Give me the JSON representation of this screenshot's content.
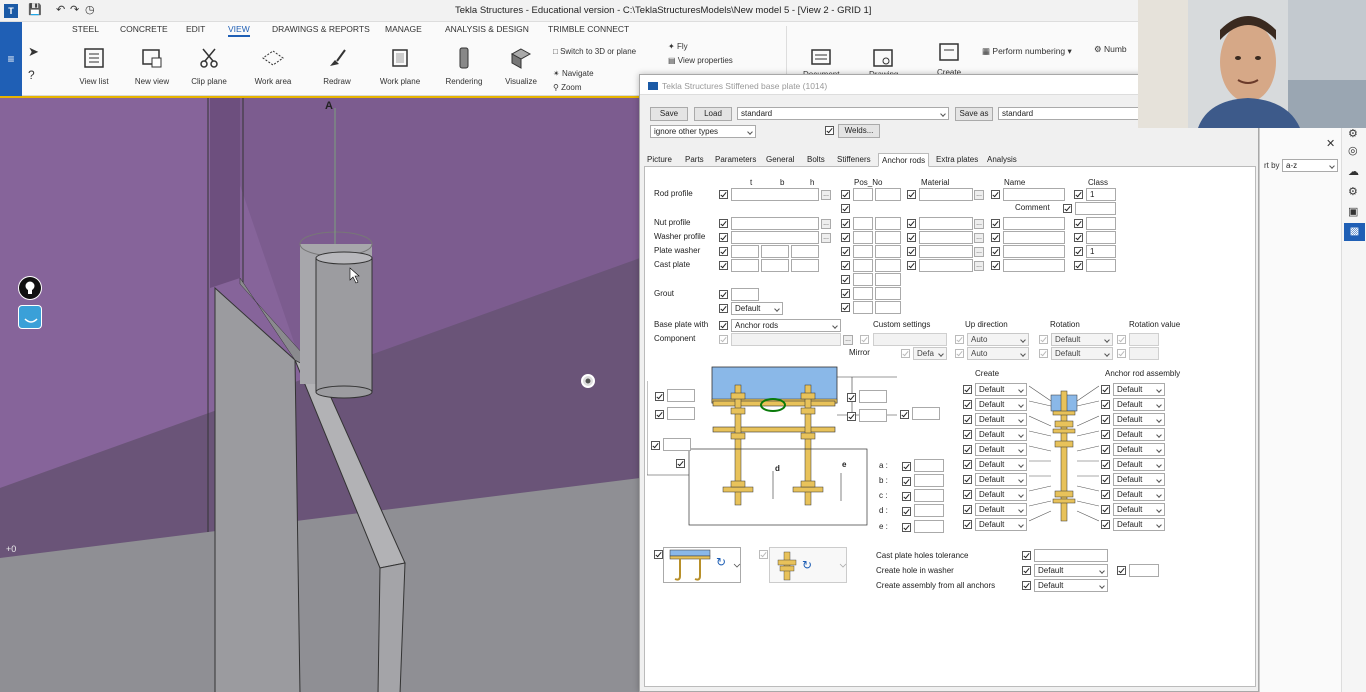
{
  "window": {
    "title": "Tekla Structures - Educational version - C:\\TeklaStructuresModels\\New model 5  - [View 2 - GRID 1]"
  },
  "ribbon": {
    "tabs": [
      "STEEL",
      "CONCRETE",
      "EDIT",
      "VIEW",
      "DRAWINGS & REPORTS",
      "MANAGE",
      "ANALYSIS & DESIGN",
      "TRIMBLE CONNECT"
    ],
    "active_tab": "VIEW",
    "tools": [
      "View list",
      "New view",
      "Clip plane",
      "Work area",
      "Redraw",
      "Work plane",
      "Rendering",
      "Visualize"
    ],
    "small_tools": {
      "switch": "Switch to 3D or plane",
      "navigate": "Navigate",
      "zoom": "Zoom",
      "fly": "Fly",
      "view_properties": "View properties",
      "perform_numbering": "Perform numbering",
      "numbering_short": "Numb",
      "document": "Document",
      "drawing": "Drawing",
      "create": "Create"
    }
  },
  "viewport": {
    "grid_label_a": "A",
    "grid_label_zero": "+0"
  },
  "dialog": {
    "title": "Tekla Structures  Stiffened base plate (1014)",
    "save_label": "Save",
    "load_label": "Load",
    "preset_value": "standard",
    "save_as_label": "Save as",
    "save_as_value": "standard",
    "ignore_value": "ignore other types",
    "welds_label": "Welds...",
    "tabs": [
      "Picture",
      "Parts",
      "Parameters",
      "General",
      "Bolts",
      "Stiffeners",
      "Anchor rods",
      "Extra plates",
      "Analysis"
    ],
    "active_tab": "Anchor rods",
    "columns": {
      "t": "t",
      "b": "b",
      "h": "h",
      "pos_no": "Pos_No",
      "material": "Material",
      "name": "Name",
      "class": "Class",
      "comment": "Comment"
    },
    "rows": {
      "rod_profile": "Rod profile",
      "nut_profile": "Nut profile",
      "washer_profile": "Washer profile",
      "plate_washer": "Plate washer",
      "cast_plate": "Cast plate",
      "grout": "Grout"
    },
    "class_values": {
      "rod": "1",
      "plate_washer": "1"
    },
    "grout_select": "Default",
    "base_plate_with_label": "Base plate with",
    "base_plate_with_value": "Anchor rods",
    "component_label": "Component",
    "custom_settings_label": "Custom settings",
    "up_direction_label": "Up direction",
    "rotation_label": "Rotation",
    "rotation_value_label": "Rotation value",
    "mirror_label": "Mirror",
    "mirror_value": "Defa",
    "up_direction_values": [
      "Auto",
      "Auto"
    ],
    "rotation_values": [
      "Default",
      "Default"
    ],
    "create_label": "Create",
    "anchor_rod_assembly_label": "Anchor rod assembly",
    "create_values": [
      "Default",
      "Default",
      "Default",
      "Default",
      "Default",
      "Default",
      "Default",
      "Default",
      "Default",
      "Default"
    ],
    "assembly_values": [
      "Default",
      "Default",
      "Default",
      "Default",
      "Default",
      "Default",
      "Default",
      "Default",
      "Default",
      "Default"
    ],
    "dims": [
      "a",
      "b",
      "c",
      "d",
      "e"
    ],
    "diagram_d": "d",
    "diagram_e": "e",
    "cast_plate_tolerance_label": "Cast plate holes tolerance",
    "create_hole_label": "Create hole in washer",
    "create_hole_value": "Default",
    "create_assembly_label": "Create assembly from all anchors",
    "create_assembly_value": "Default"
  },
  "rightpanel": {
    "sort_label": "rt by",
    "sort_value": "a-z"
  }
}
